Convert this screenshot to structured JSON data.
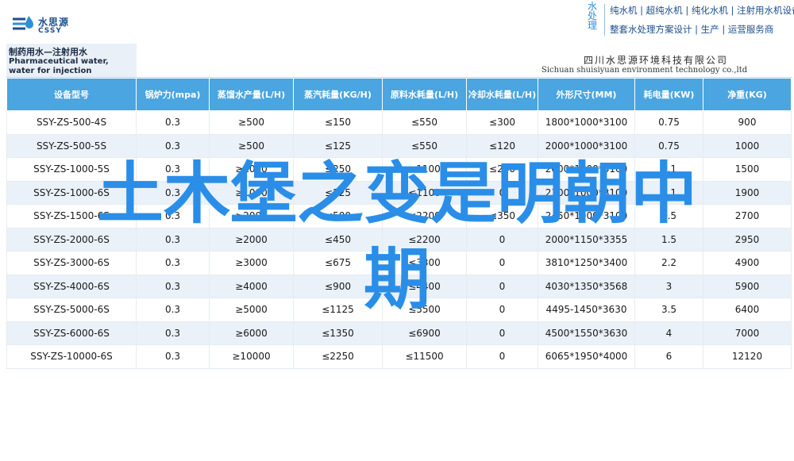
{
  "header": {
    "logo_cn": "水思源",
    "logo_en": "CSSY",
    "side_label": [
      "水",
      "处",
      "理"
    ],
    "slogan_line1": "纯水机 | 超纯水机 | 纯化水机 | 注射用水机设备",
    "slogan_line2": "整套水处理方案设计 | 生产 | 运营服务商"
  },
  "product": {
    "title_cn": "制药用水—注射用水",
    "title_en": "Pharmaceutical water, water for injection"
  },
  "company": {
    "name_cn": "四川水思源环境科技有限公司",
    "name_en": "Sichuan shuisiyuan environment technology co.,ltd"
  },
  "table": {
    "headers": [
      "设备型号",
      "锅炉力(mpa)",
      "蒸馏水产量(L/H)",
      "蒸汽耗量(KG/H)",
      "原料水耗量(L/H)",
      "冷却水耗量(L/H)",
      "外形尺寸(MM)",
      "耗电量(KW)",
      "净重(KG)"
    ],
    "rows": [
      [
        "SSY-ZS-500-4S",
        "0.3",
        "≥500",
        "≤150",
        "≤550",
        "≤300",
        "1800*1000*3100",
        "0.75",
        "900"
      ],
      [
        "SSY-ZS-500-5S",
        "0.3",
        "≥500",
        "≤125",
        "≤550",
        "≤120",
        "2000*1000*3100",
        "0.75",
        "1000"
      ],
      [
        "SSY-ZS-1000-5S",
        "0.3",
        "≥1000",
        "≤250",
        "≤1100",
        "≤240",
        "2000*1000*3100",
        "1.1",
        "1500"
      ],
      [
        "SSY-ZS-1000-6S",
        "0.3",
        "≥1000",
        "≤225",
        "≤1100",
        "0",
        "2300*1000*3100",
        "1.1",
        "1900"
      ],
      [
        "SSY-ZS-1500-6S",
        "0.3",
        "≥2000",
        "≤500",
        "≤2200",
        "≤350",
        "2450*1000*3100",
        "1.5",
        "2700"
      ],
      [
        "SSY-ZS-2000-6S",
        "0.3",
        "≥2000",
        "≤450",
        "≤2200",
        "0",
        "2000*1150*3355",
        "1.5",
        "2950"
      ],
      [
        "SSY-ZS-3000-6S",
        "0.3",
        "≥3000",
        "≤675",
        "≤3300",
        "0",
        "3810*1250*3400",
        "2.2",
        "4900"
      ],
      [
        "SSY-ZS-4000-6S",
        "0.3",
        "≥4000",
        "≤900",
        "≤4400",
        "0",
        "4030*1350*3568",
        "3",
        "5900"
      ],
      [
        "SSY-ZS-5000-6S",
        "0.3",
        "≥5000",
        "≤1125",
        "≤5500",
        "0",
        "4495-1450*3630",
        "3.5",
        "6400"
      ],
      [
        "SSY-ZS-6000-6S",
        "0.3",
        "≥6000",
        "≤1350",
        "≤6900",
        "0",
        "4500*1550*3630",
        "4",
        "7000"
      ],
      [
        "SSY-ZS-10000-6S",
        "0.3",
        "≥10000",
        "≤2250",
        "≤11500",
        "0",
        "6065*1950*4000",
        "6",
        "12120"
      ]
    ]
  },
  "overlay": {
    "line1": "土木堡之变是明朝中",
    "line2": "期"
  },
  "colors": {
    "header_blue": "#4aa5e0",
    "brand_navy": "#1f4e8c",
    "overlay_blue": "#2a8ee8",
    "row_alt": "#eaf1f8"
  }
}
